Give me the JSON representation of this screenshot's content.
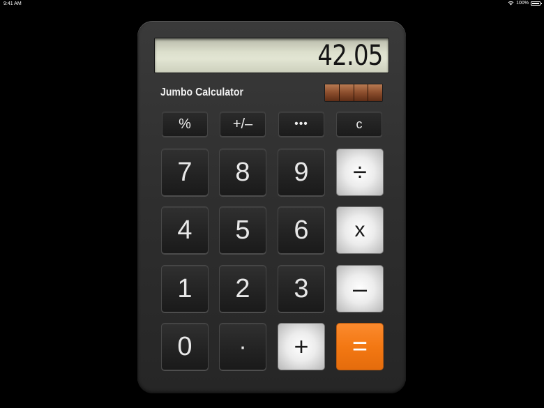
{
  "status_bar": {
    "time": "9:41 AM",
    "battery": "100%"
  },
  "app": {
    "name": "Jumbo Calculator"
  },
  "display": {
    "value": "42.05"
  },
  "function_keys": {
    "percent": "%",
    "plus_minus": "+/–",
    "more": "•••",
    "clear": "c"
  },
  "number_keys": {
    "seven": "7",
    "eight": "8",
    "nine": "9",
    "four": "4",
    "five": "5",
    "six": "6",
    "one": "1",
    "two": "2",
    "three": "3",
    "zero": "0",
    "decimal": "·"
  },
  "operator_keys": {
    "divide": "÷",
    "multiply": "x",
    "subtract": "–",
    "add": "+",
    "equals": "="
  },
  "colors": {
    "equals_accent": "#f37813",
    "body": "#2e2e2e",
    "display_bg": "#dcdfcc"
  }
}
